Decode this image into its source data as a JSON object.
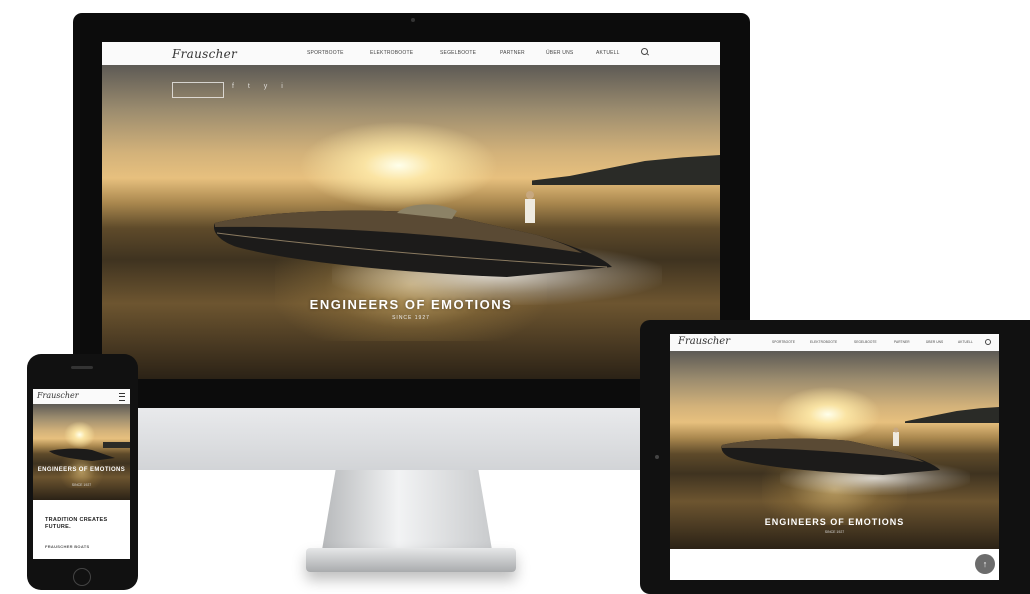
{
  "brand": {
    "logo_text": "Frauscher"
  },
  "nav": {
    "items": [
      "SPORTBOOTE",
      "ELEKTROBOOTE",
      "SEGELBOOTE",
      "PARTNER",
      "ÜBER UNS",
      "AKTUELL"
    ],
    "search_icon": "search-icon"
  },
  "hero": {
    "headline": "ENGINEERS OF EMOTIONS",
    "subline": "SINCE 1927",
    "social_icons": [
      "f",
      "t",
      "y",
      "i"
    ]
  },
  "phone": {
    "headline_lines": "ENGINEERS OF EMOTIONS",
    "subline": "SINCE 1927",
    "tagline": "TRADITION CREATES FUTURE.",
    "more_link": "FRAUSCHER BOATS",
    "menu_icon": "hamburger-menu-icon"
  },
  "tablet": {
    "scroll_button_icon": "chevron-up-icon",
    "scroll_button_glyph": "↑"
  }
}
